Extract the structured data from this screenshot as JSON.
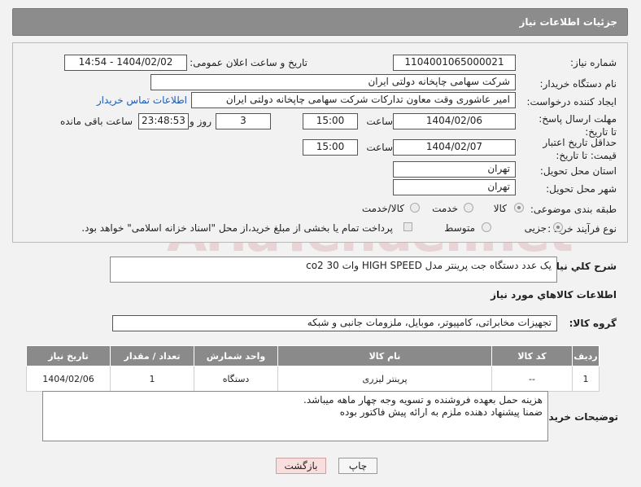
{
  "header": {
    "title": "جزئیات اطلاعات نیاز"
  },
  "watermark": "AriaTender.net",
  "fields": {
    "need_number_label": "شماره نیاز:",
    "need_number": "1104001065000021",
    "announce_label": "تاریخ و ساعت اعلان عمومی:",
    "announce_value": "1404/02/02 - 14:54",
    "buyer_org_label": "نام دستگاه خریدار:",
    "buyer_org": "شرکت سهامی چاپخانه دولتی ایران",
    "creator_label": "ایجاد کننده درخواست:",
    "creator": "امیر عاشوری وقت معاون تدارکات شرکت سهامی چاپخانه دولتی ایران",
    "contact_link": "اطلاعات تماس خریدار",
    "deadline_label": "مهلت ارسال پاسخ: تا تاریخ:",
    "deadline_date": "1404/02/06",
    "time_label": "ساعت",
    "deadline_time": "15:00",
    "days_value": "3",
    "days_label": "روز و",
    "remaining_time": "23:48:53",
    "remaining_label": "ساعت باقی مانده",
    "validity_label": "حداقل تاریخ اعتبار قیمت: تا تاریخ:",
    "validity_date": "1404/02/07",
    "validity_time": "15:00",
    "province_label": "استان محل تحویل:",
    "province": "تهران",
    "city_label": "شهر محل تحویل:",
    "city": "تهران",
    "category_label": "طبقه بندی موضوعی:",
    "category_options": [
      "کالا",
      "خدمت",
      "کالا/خدمت"
    ],
    "process_label": "نوع فرآیند خرید :",
    "process_options": [
      "جزیی",
      "متوسط"
    ],
    "process_note": "پرداخت تمام یا بخشی از مبلغ خرید،از محل \"اسناد خزانه اسلامی\" خواهد بود."
  },
  "description": {
    "label": "شرح کلي نياز:",
    "value": "یک عدد دستگاه جت پرینتر مدل HIGH SPEED  وات   30   co2"
  },
  "goods": {
    "section_title": "اطلاعات کالاهاي مورد نياز",
    "group_label": "گروه کالا:",
    "group_value": "تجهیزات مخابراتی، کامپیوتر، موبایل، ملزومات جانبی و شبکه",
    "columns": [
      "ردیف",
      "کد کالا",
      "نام کالا",
      "واحد شمارش",
      "تعداد / مقدار",
      "تاریخ نیاز"
    ],
    "rows": [
      [
        "1",
        "--",
        "پرینتر لیزری",
        "دستگاه",
        "1",
        "1404/02/06"
      ]
    ]
  },
  "buyer_notes": {
    "label": "توضیحات خریدار:",
    "line1": "هزینه حمل بعهده فروشنده و تسویه وجه چهار  ماهه  میباشد.",
    "line2": "ضمنا پیشنهاد دهنده ملزم به ارائه پیش فاکتور بوده"
  },
  "buttons": {
    "print": "چاپ",
    "back": "بازگشت"
  },
  "colors": {
    "header_bg": "#8c8c8c",
    "link": "#1a5cb8",
    "back_button_bg": "#f9dede"
  }
}
